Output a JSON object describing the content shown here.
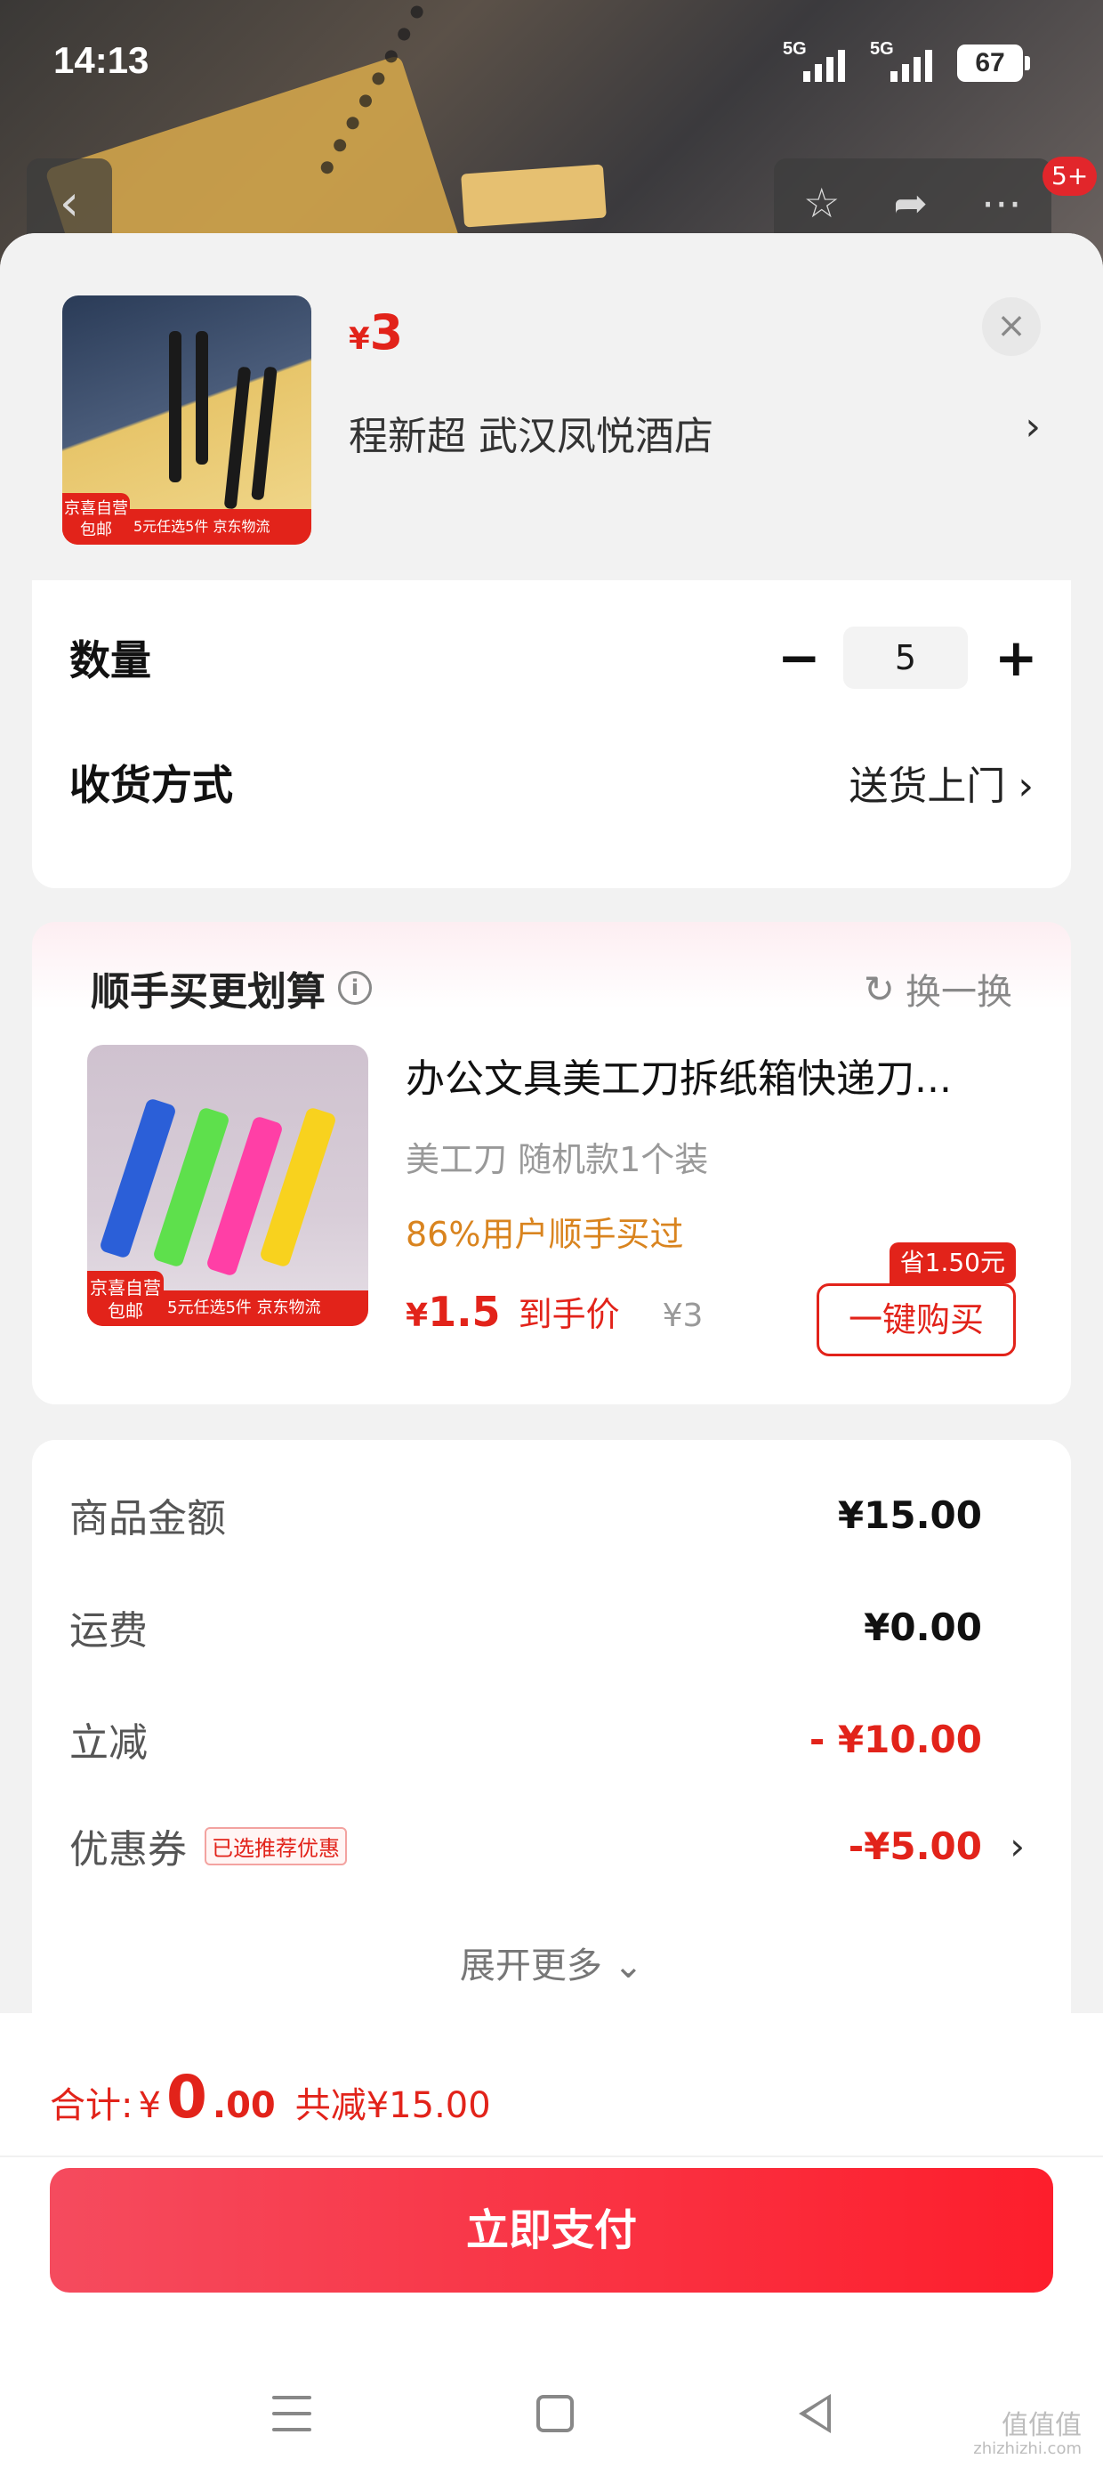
{
  "status_bar": {
    "time": "14:13",
    "signal1_label": "5G",
    "signal2_label": "5G",
    "battery": "67"
  },
  "top_nav": {
    "badge": "5+"
  },
  "sheet": {
    "product": {
      "price_currency": "¥",
      "price_value": "3",
      "shop_line": "程新超  武汉凤悦酒店",
      "thumb_tag_top": "京喜自营",
      "thumb_tag_bottom": "包邮",
      "thumb_tagline": "5元任选5件 京东物流"
    },
    "quantity": {
      "label": "数量",
      "value": "5",
      "minus": "−",
      "plus": "+"
    },
    "delivery": {
      "label": "收货方式",
      "value": "送货上门"
    },
    "addon": {
      "title": "顺手买更划算",
      "swap_label": "换一换",
      "item_name": "办公文具美工刀拆纸箱快递刀...",
      "item_spec": "美工刀   随机款1个装",
      "bought_note": "86%用户顺手买过",
      "price_currency": "¥",
      "price_value": "1.5",
      "price_sub": "到手价",
      "orig_price": "¥3",
      "save_tag": "省1.50元",
      "buy_label": "一键购买",
      "img_tag_top": "京喜自营",
      "img_tag_bottom": "包邮",
      "img_tagline": "5元任选5件 京东物流"
    },
    "summary": {
      "rows": [
        {
          "label": "商品金额",
          "value": "¥15.00"
        },
        {
          "label": "运费",
          "value": "¥0.00"
        },
        {
          "label": "立减",
          "value": "- ¥10.00"
        },
        {
          "label": "优惠券",
          "value": "-¥5.00",
          "tag": "已选推荐优惠"
        }
      ],
      "expand_label": "展开更多 ⌄"
    }
  },
  "footer": {
    "total_label": "合计:",
    "total_currency": "¥",
    "total_int": "0",
    "total_dec": ".00",
    "reduce_text": "共减¥15.00",
    "pay_label": "立即支付"
  },
  "watermark": {
    "main": "值值值",
    "sub": "zhizhizhi.com"
  },
  "colors": {
    "accent_red": "#e2231a",
    "pay_button": "#fd1e2c",
    "bought_orange": "#d9841f"
  },
  "icons": [
    "back-arrow-icon",
    "star-icon",
    "share-icon",
    "more-icon",
    "close-icon",
    "chevron-right-icon",
    "info-icon",
    "refresh-icon",
    "menu-icon",
    "home-icon",
    "back-triangle-icon"
  ]
}
